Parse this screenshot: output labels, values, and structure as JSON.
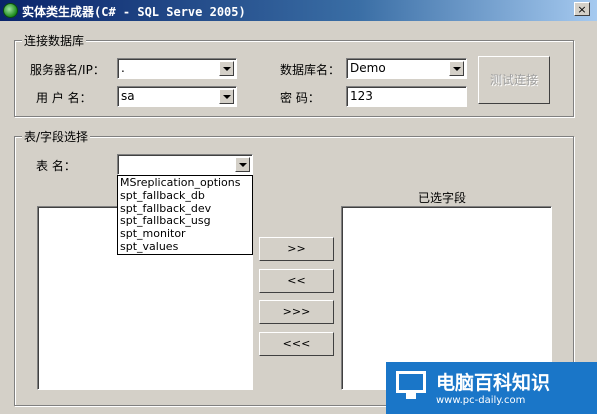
{
  "window": {
    "title": "实体类生成器(C# - SQL Serve 2005)",
    "close_label": "×"
  },
  "connection": {
    "legend": "连接数据库",
    "server_label": "服务器名/IP：",
    "server_value": ".",
    "database_label": "数据库名：",
    "database_value": "Demo",
    "user_label": "用 户 名：",
    "user_value": "sa",
    "password_label": "密  码：",
    "password_value": "123",
    "test_button": "测试连接"
  },
  "tables": {
    "legend": "表/字段选择",
    "table_label": "表  名：",
    "table_value": "",
    "dropdown_options": [
      "MSreplication_options",
      "spt_fallback_db",
      "spt_fallback_dev",
      "spt_fallback_usg",
      "spt_monitor",
      "spt_values"
    ],
    "selected_fields_label": "已选字段",
    "buttons": {
      "add": ">>",
      "remove": "<<",
      "add_all": ">>>",
      "remove_all": "<<<"
    }
  },
  "watermark": {
    "name": "电脑百科知识",
    "url": "www.pc-daily.com"
  }
}
